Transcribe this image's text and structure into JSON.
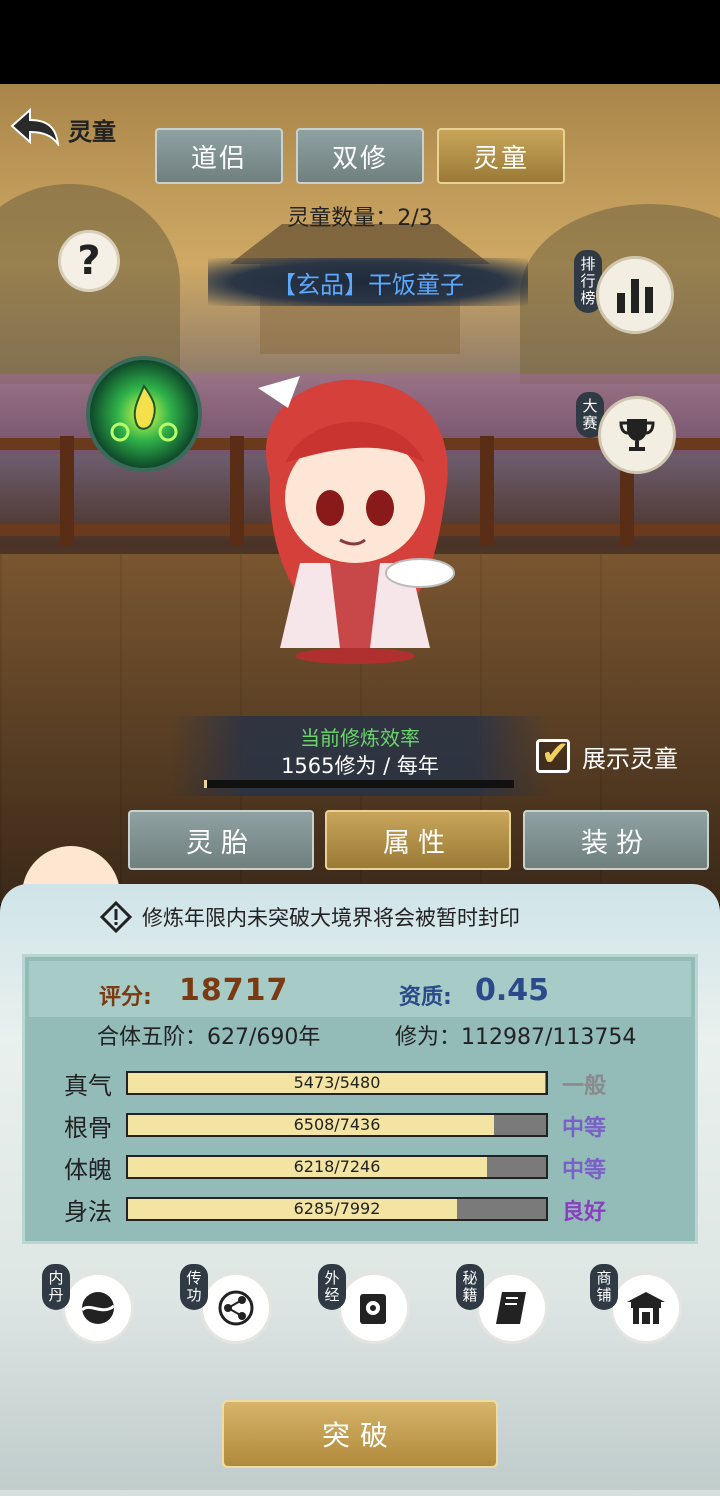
{
  "header": {
    "back_label": "灵童"
  },
  "tabs": [
    {
      "label": "道侣",
      "active": false
    },
    {
      "label": "双修",
      "active": false
    },
    {
      "label": "灵童",
      "active": true
    }
  ],
  "spirit_count": "灵童数量：2/3",
  "help_symbol": "?",
  "spirit_name": "【玄品】干饭童子",
  "side_buttons": {
    "ranking": {
      "tag": "排行榜",
      "icon": "bar-chart-icon"
    },
    "contest": {
      "tag": "大赛",
      "icon": "trophy-icon"
    }
  },
  "cultivation": {
    "title": "当前修炼效率",
    "value": "1565修为 / 每年",
    "progress_fraction": 0.01
  },
  "show_toggle": {
    "label": "展示灵童",
    "checked": true
  },
  "sub_tabs": [
    {
      "label": "灵胎",
      "active": false
    },
    {
      "label": "属性",
      "active": true
    },
    {
      "label": "装扮",
      "active": false
    }
  ],
  "warning": "修炼年限内未突破大境界将会被暂时封印",
  "stats": {
    "score_label": "评分:",
    "score_value": "18717",
    "aptitude_label": "资质:",
    "aptitude_value": "0.45",
    "realm": "合体五阶：627/690年",
    "cultivation": "修为：112987/113754",
    "attributes": [
      {
        "name": "真气",
        "value": "5473/5480",
        "fraction": 0.9987,
        "grade": "一般",
        "grade_color": "#8a8a8a"
      },
      {
        "name": "根骨",
        "value": "6508/7436",
        "fraction": 0.8752,
        "grade": "中等",
        "grade_color": "#7a5fc8"
      },
      {
        "name": "体魄",
        "value": "6218/7246",
        "fraction": 0.8581,
        "grade": "中等",
        "grade_color": "#7a5fc8"
      },
      {
        "name": "身法",
        "value": "6285/7992",
        "fraction": 0.7864,
        "grade": "良好",
        "grade_color": "#8a3fc0"
      }
    ]
  },
  "features": [
    {
      "tag": "内丹",
      "icon": "inner-pill-icon"
    },
    {
      "tag": "传功",
      "icon": "transfer-skill-icon"
    },
    {
      "tag": "外经",
      "icon": "scroll-icon"
    },
    {
      "tag": "秘籍",
      "icon": "book-icon"
    },
    {
      "tag": "商铺",
      "icon": "shop-icon"
    }
  ],
  "breakthrough_label": "突破",
  "colors": {
    "gold": "#c8a55a",
    "teal_panel": "#93bcb8",
    "name_blue": "#5ca8ff",
    "rate_green": "#6bd46b"
  }
}
